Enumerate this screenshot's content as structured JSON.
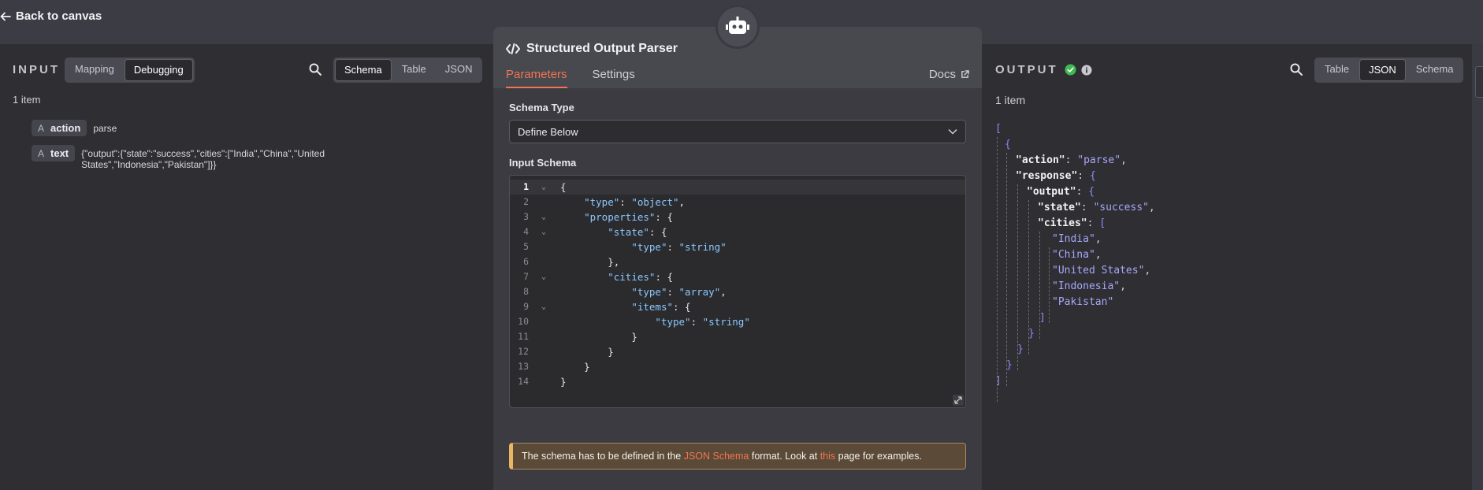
{
  "topbar": {
    "back_label": "Back to canvas"
  },
  "input_panel": {
    "title": "INPUT",
    "mode_tabs": [
      "Mapping",
      "Debugging"
    ],
    "view_tabs": [
      "Schema",
      "Table",
      "JSON"
    ],
    "item_count": "1 item",
    "fields": [
      {
        "type": "A",
        "key": "action",
        "value": "parse"
      },
      {
        "type": "A",
        "key": "text",
        "value_line1": "{\"output\":{\"state\":\"success\",\"cities\":[\"India\",\"China\",\"United",
        "value_line2": "States\",\"Indonesia\",\"Pakistan\"]}}"
      }
    ]
  },
  "modal": {
    "title": "Structured Output Parser",
    "tabs": [
      "Parameters",
      "Settings"
    ],
    "docs_label": "Docs",
    "schema_type_label": "Schema Type",
    "schema_type_value": "Define Below",
    "input_schema_label": "Input Schema",
    "code_lines": [
      {
        "n": "1",
        "fold": "⌄"
      },
      {
        "n": "2",
        "fold": ""
      },
      {
        "n": "3",
        "fold": "⌄"
      },
      {
        "n": "4",
        "fold": "⌄"
      },
      {
        "n": "5",
        "fold": ""
      },
      {
        "n": "6",
        "fold": ""
      },
      {
        "n": "7",
        "fold": "⌄"
      },
      {
        "n": "8",
        "fold": ""
      },
      {
        "n": "9",
        "fold": "⌄"
      },
      {
        "n": "10",
        "fold": ""
      },
      {
        "n": "11",
        "fold": ""
      },
      {
        "n": "12",
        "fold": ""
      },
      {
        "n": "13",
        "fold": ""
      },
      {
        "n": "14",
        "fold": ""
      }
    ],
    "code_tokens": {
      "l1": "{",
      "l2_key": "\"type\"",
      "l2_val": "\"object\"",
      "l3_key": "\"properties\"",
      "l3_rest": ": {",
      "l4_key": "\"state\"",
      "l4_rest": ": {",
      "l5_key": "\"type\"",
      "l5_val": "\"string\"",
      "l6": "},",
      "l7_key": "\"cities\"",
      "l7_rest": ": {",
      "l8_key": "\"type\"",
      "l8_val": "\"array\"",
      "l9_key": "\"items\"",
      "l9_rest": ": {",
      "l10_key": "\"type\"",
      "l10_val": "\"string\"",
      "l11": "}",
      "l12": "}",
      "l13": "}",
      "l14": "}"
    },
    "notice": {
      "text1": "The schema has to be defined in the ",
      "link1": "JSON Schema",
      "text2": " format. Look at ",
      "link2": "this",
      "text3": " page for examples."
    }
  },
  "output_panel": {
    "title": "OUTPUT",
    "view_tabs": [
      "Table",
      "JSON",
      "Schema"
    ],
    "item_count": "1 item",
    "json": {
      "open_bracket": "[",
      "open_brace": "{",
      "action_key": "\"action\"",
      "action_val": "\"parse\"",
      "response_key": "\"response\"",
      "output_key": "\"output\"",
      "state_key": "\"state\"",
      "state_val": "\"success\"",
      "cities_key": "\"cities\"",
      "cities": [
        "\"India\"",
        "\"China\"",
        "\"United States\"",
        "\"Indonesia\"",
        "\"Pakistan\""
      ],
      "close_bracket": "]",
      "close_brace": "}"
    }
  },
  "colors": {
    "accent": "#f07553",
    "success": "#3fb950",
    "background": "#2e2e33"
  }
}
